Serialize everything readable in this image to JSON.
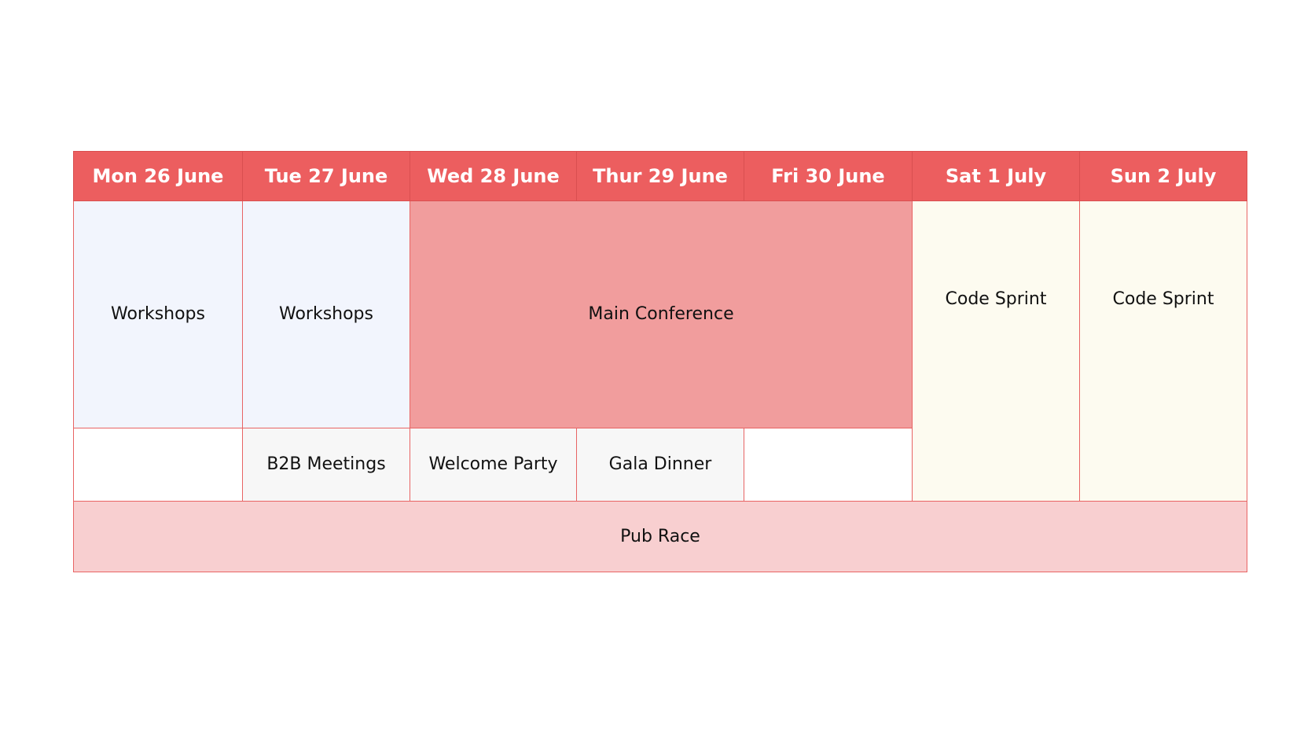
{
  "days": [
    "Mon 26 June",
    "Tue 27 June",
    "Wed 28 June",
    "Thur 29 June",
    "Fri 30 June",
    "Sat 1 July",
    "Sun 2 July"
  ],
  "events": {
    "workshops_mon": "Workshops",
    "workshops_tue": "Workshops",
    "main_conference": "Main Conference",
    "code_sprint_sat": "Code Sprint",
    "code_sprint_sun": "Code Sprint",
    "b2b_meetings": "B2B Meetings",
    "welcome_party": "Welcome Party",
    "gala_dinner": "Gala Dinner",
    "pub_race": "Pub Race"
  },
  "colors": {
    "header": "#ec5e5f",
    "border": "#e86464",
    "workshops": "#f2f5fd",
    "main_conference": "#f19d9d",
    "code_sprint": "#fdfbf0",
    "evening": "#f7f7f7",
    "pub_race": "#f8cfd0"
  }
}
